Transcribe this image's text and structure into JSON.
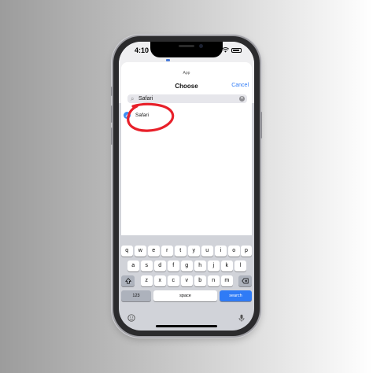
{
  "status_bar": {
    "time": "4:10"
  },
  "sheet": {
    "context_label": "App",
    "title": "Choose",
    "cancel_label": "Cancel"
  },
  "search": {
    "value": "Safari"
  },
  "results": [
    {
      "label": "Safari",
      "icon": "safari-icon"
    }
  ],
  "annotation": {
    "color": "#e8202a",
    "shape": "hand-drawn circle"
  },
  "keyboard": {
    "row1": [
      "q",
      "w",
      "e",
      "r",
      "t",
      "y",
      "u",
      "i",
      "o",
      "p"
    ],
    "row2": [
      "a",
      "s",
      "d",
      "f",
      "g",
      "h",
      "j",
      "k",
      "l"
    ],
    "row3": [
      "z",
      "x",
      "c",
      "v",
      "b",
      "n",
      "m"
    ],
    "numbers_label": "123",
    "space_label": "space",
    "search_label": "search",
    "accent_color": "#2f7bf6"
  }
}
